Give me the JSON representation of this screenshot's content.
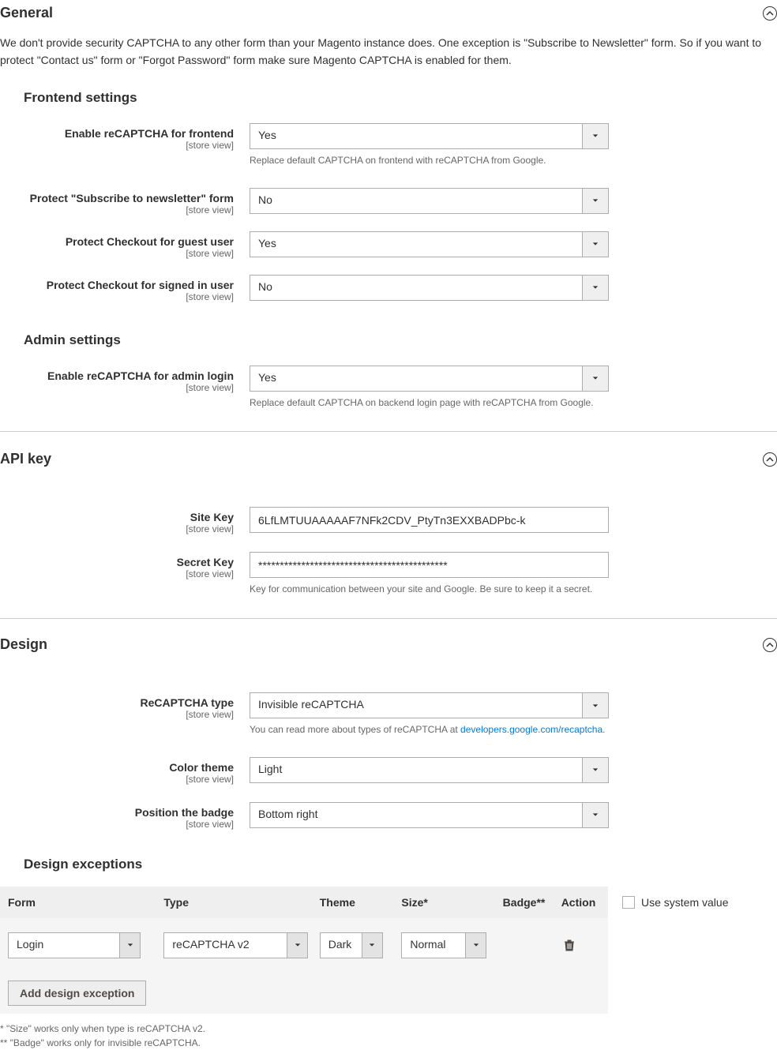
{
  "general": {
    "title": "General",
    "description": "We don't provide security CAPTCHA to any other form than your Magento instance does. One exception is \"Subscribe to Newsletter\" form. So if you want to protect \"Contact us\" form or \"Forgot Password\" form make sure Magento CAPTCHA is enabled for them.",
    "frontend_title": "Frontend settings",
    "admin_title": "Admin settings",
    "scope": "[store view]",
    "fields": {
      "enable_frontend": {
        "label": "Enable reCAPTCHA for frontend",
        "value": "Yes",
        "note": "Replace default CAPTCHA on frontend with reCAPTCHA from Google."
      },
      "protect_newsletter": {
        "label": "Protect \"Subscribe to newsletter\" form",
        "value": "No"
      },
      "protect_checkout_guest": {
        "label": "Protect Checkout for guest user",
        "value": "Yes"
      },
      "protect_checkout_signed": {
        "label": "Protect Checkout for signed in user",
        "value": "No"
      },
      "enable_admin": {
        "label": "Enable reCAPTCHA for admin login",
        "value": "Yes",
        "note": "Replace default CAPTCHA on backend login page with reCAPTCHA from Google."
      }
    }
  },
  "api": {
    "title": "API key",
    "fields": {
      "site_key": {
        "label": "Site Key",
        "value": "6LfLMTUUAAAAAF7NFk2CDV_PtyTn3EXXBADPbc-k"
      },
      "secret_key": {
        "label": "Secret Key",
        "value": "********************************************",
        "note": "Key for communication between your site and Google. Be sure to keep it a secret."
      }
    }
  },
  "design": {
    "title": "Design",
    "fields": {
      "type": {
        "label": "ReCAPTCHA type",
        "value": "Invisible reCAPTCHA",
        "note_prefix": "You can read more about types of reCAPTCHA at ",
        "note_link": "developers.google.com/recaptcha",
        "note_suffix": "."
      },
      "theme": {
        "label": "Color theme",
        "value": "Light"
      },
      "position": {
        "label": "Position the badge",
        "value": "Bottom right"
      }
    },
    "exceptions_title": "Design exceptions",
    "table": {
      "headers": {
        "form": "Form",
        "type": "Type",
        "theme": "Theme",
        "size": "Size*",
        "badge": "Badge**",
        "action": "Action"
      },
      "row": {
        "form": "Login",
        "type": "reCAPTCHA v2",
        "theme": "Dark",
        "size": "Normal"
      },
      "add_button": "Add design exception"
    },
    "use_system_value": "Use system value",
    "footnote1": "* \"Size\" works only when type is reCAPTCHA v2.",
    "footnote2": "** \"Badge\" works only for invisible reCAPTCHA."
  }
}
